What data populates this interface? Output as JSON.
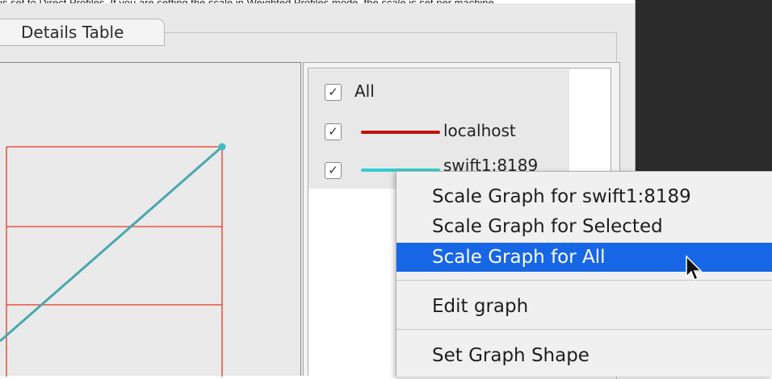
{
  "caption": "is set to Direct Profiles. If you are setting the scale in Weighted Profiles mode, the scale is set per machine.",
  "tabs": [
    {
      "label": "Details Table"
    }
  ],
  "legend": {
    "all": {
      "label": "All",
      "checked": "✓"
    },
    "items": [
      {
        "label": "localhost",
        "checked": "✓",
        "color": "#c0100c"
      },
      {
        "label": "swift1:8189",
        "checked": "✓",
        "color": "#2ecece"
      }
    ]
  },
  "graph": {
    "grid_color": "#ee3322",
    "series_color": "#4aa7ad"
  },
  "context_menu": {
    "items": [
      {
        "label": "Scale Graph for swift1:8189",
        "selected": false
      },
      {
        "label": "Scale Graph for Selected",
        "selected": false
      },
      {
        "label": "Scale Graph for All",
        "selected": true
      },
      {
        "label": "Edit graph",
        "selected": false
      },
      {
        "label": "Set Graph Shape",
        "selected": false
      }
    ]
  },
  "colors": {
    "accent": "#1766e5",
    "dark_pane": "#2b2b2b"
  }
}
